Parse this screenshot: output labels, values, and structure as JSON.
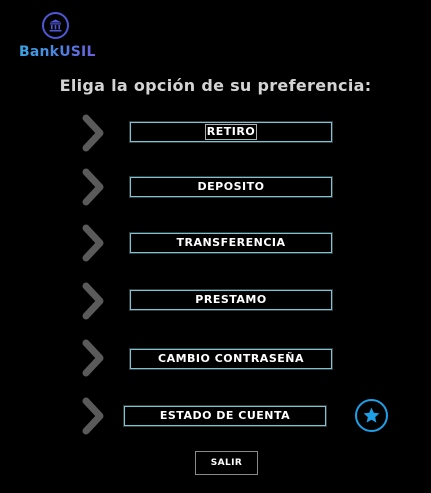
{
  "brand": {
    "name": "BankUSIL",
    "icon": "bank-icon"
  },
  "heading": "Eliga la opción de su preferencia:",
  "options": [
    {
      "label": "RETIRO",
      "icon": "chevron-right-icon"
    },
    {
      "label": "DEPOSITO",
      "icon": "chevron-right-icon"
    },
    {
      "label": "TRANSFERENCIA",
      "icon": "chevron-right-icon"
    },
    {
      "label": "PRESTAMO",
      "icon": "chevron-right-icon"
    },
    {
      "label": "CAMBIO CONTRASEÑA",
      "icon": "chevron-right-icon"
    },
    {
      "label": "ESTADO DE CUENTA",
      "icon": "chevron-right-icon"
    }
  ],
  "favorite_icon": "star-icon",
  "exit_label": "SALIR",
  "colors": {
    "background": "#000000",
    "heading": "#d3d3d3",
    "button_border": "#70c8d8",
    "chevron": "#5a5a5a",
    "brand_gradient_start": "#3aa6e6",
    "brand_gradient_end": "#6b5fdc",
    "logo_ring": "#4f57d6",
    "star": "#1e9fe8"
  }
}
